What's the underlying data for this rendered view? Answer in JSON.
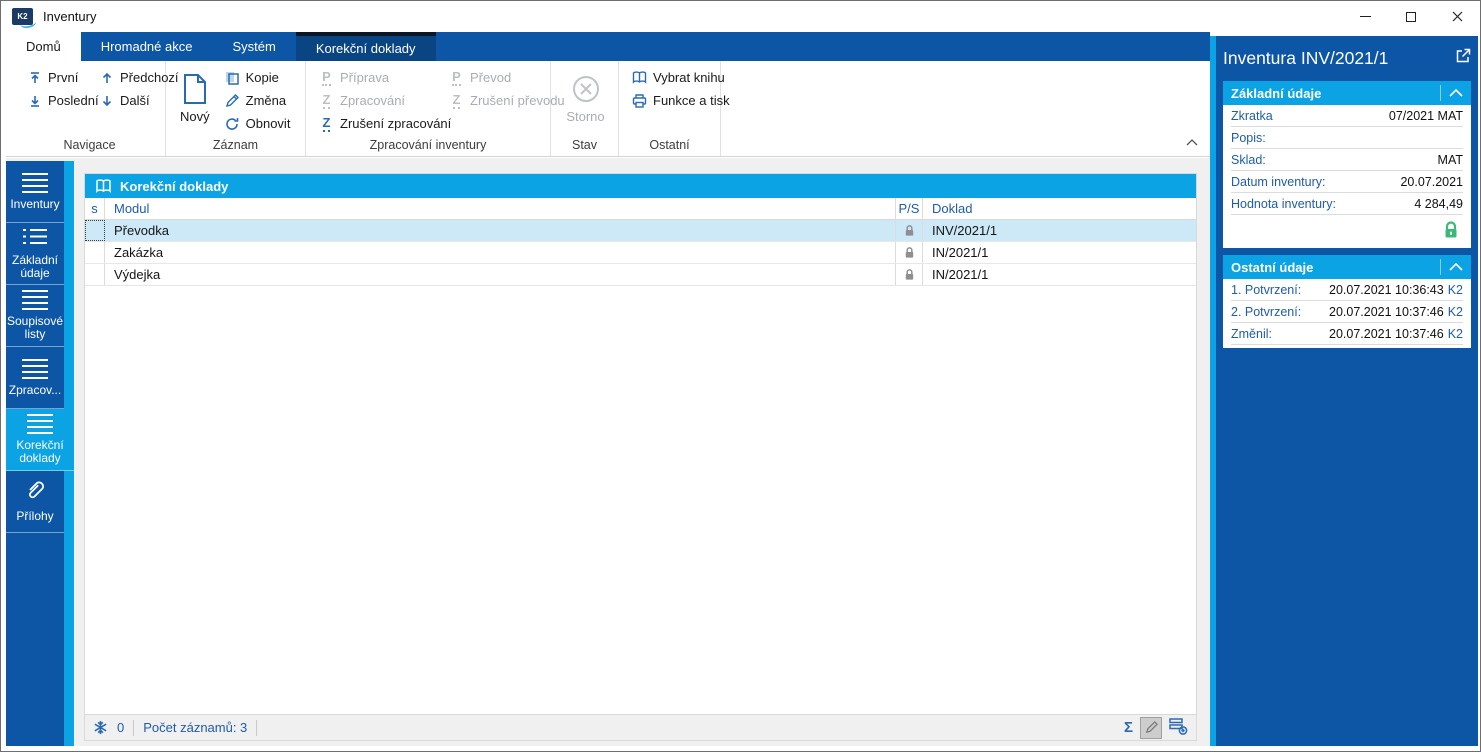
{
  "window": {
    "title": "Inventury"
  },
  "ribbon": {
    "tabs": [
      {
        "label": "Domů"
      },
      {
        "label": "Hromadné akce"
      },
      {
        "label": "Systém"
      },
      {
        "label": "Korekční doklady"
      }
    ],
    "navigace": {
      "label": "Navigace",
      "first": "První",
      "last": "Poslední",
      "prev": "Předchozí",
      "next": "Další"
    },
    "zaznam": {
      "label": "Záznam",
      "new": "Nový",
      "copy": "Kopie",
      "change": "Změna",
      "refresh": "Obnovit"
    },
    "zpracovani": {
      "label": "Zpracování inventury",
      "priprava": "Příprava",
      "zpracovani": "Zpracování",
      "zruseni_zpracovani": "Zrušení zpracování",
      "prevod": "Převod",
      "zruseni_prevodu": "Zrušení převodu"
    },
    "stav": {
      "label": "Stav",
      "storno": "Storno"
    },
    "ostatni": {
      "label": "Ostatní",
      "vybrat_knihu": "Vybrat knihu",
      "funkce_a_tisk": "Funkce a tisk"
    }
  },
  "icons": {
    "p_glyph": "P",
    "z_glyph": "Z",
    "sigma_glyph": "Σ"
  },
  "sidebar": {
    "items": [
      {
        "label": "Inventury",
        "icon": "menu-icon"
      },
      {
        "label": "Základní údaje",
        "icon": "list-icon"
      },
      {
        "label": "Soupisové listy",
        "icon": "menu-icon"
      },
      {
        "label": "Zpracov...",
        "icon": "menu-icon"
      },
      {
        "label": "Korekční doklady",
        "icon": "menu-icon",
        "active": true
      },
      {
        "label": "Přílohy",
        "icon": "paperclip-icon"
      }
    ]
  },
  "table": {
    "title": "Korekční doklady",
    "columns": {
      "s": "s",
      "modul": "Modul",
      "ps": "P/S",
      "doklad": "Doklad"
    },
    "rows": [
      {
        "modul": "Převodka",
        "doklad": "INV/2021/1",
        "locked": true,
        "selected": true
      },
      {
        "modul": "Zakázka",
        "doklad": "IN/2021/1",
        "locked": true
      },
      {
        "modul": "Výdejka",
        "doklad": "IN/2021/1",
        "locked": true
      }
    ],
    "status": {
      "counter": "0",
      "records": "Počet záznamů: 3"
    }
  },
  "detail": {
    "title": "Inventura INV/2021/1",
    "basic": {
      "title": "Základní údaje",
      "rows": [
        {
          "label": "Zkratka",
          "value": "07/2021 MAT"
        },
        {
          "label": "Popis:",
          "value": ""
        },
        {
          "label": "Sklad:",
          "value": "MAT"
        },
        {
          "label": "Datum inventury:",
          "value": "20.07.2021"
        },
        {
          "label": "Hodnota inventury:",
          "value": "4 284,49"
        }
      ],
      "locked": true
    },
    "other": {
      "title": "Ostatní údaje",
      "rows": [
        {
          "label": "1. Potvrzení:",
          "value": "20.07.2021 10:36:43",
          "user": "K2"
        },
        {
          "label": "2. Potvrzení:",
          "value": "20.07.2021 10:37:46",
          "user": "K2"
        },
        {
          "label": "Změnil:",
          "value": "20.07.2021 10:37:46",
          "user": "K2"
        }
      ]
    }
  },
  "colors": {
    "dark_blue": "#0d56a6",
    "accent_cyan": "#0ba3e3",
    "contextual_tab": "#0a4583",
    "selected_row": "#cde9f8",
    "label_blue": "#1f5ca9",
    "icon_blue": "#2a6ab2",
    "disabled_gray": "#a9adb2",
    "lock_gray": "#8f8f8f",
    "lock_green": "#3cb878",
    "panel_gray": "#f0f0f0"
  }
}
